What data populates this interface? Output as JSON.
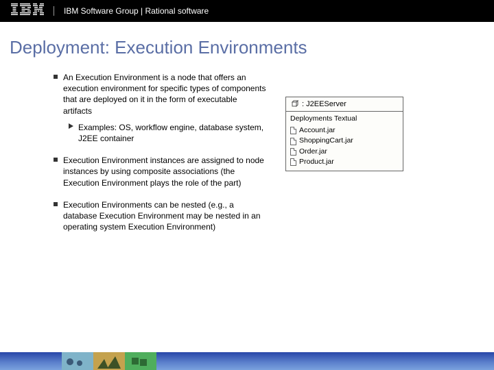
{
  "header": {
    "breadcrumb": "IBM Software Group | Rational software"
  },
  "title": "Deployment: Execution Environments",
  "bullets": [
    {
      "text": "An Execution Environment is a node that offers an execution environment for specific types of components that are deployed on it in the form of executable artifacts",
      "sub": [
        "Examples: OS, workflow engine, database system, J2EE container"
      ]
    },
    {
      "text": "Execution Environment instances are assigned to node instances by using composite associations (the Execution Environment plays the role of the part)"
    },
    {
      "text": "Execution Environments can be nested (e.g., a database Execution Environment may be nested in an operating system Execution Environment)"
    }
  ],
  "diagram": {
    "node_title": ": J2EEServer",
    "section_label": "Deployments Textual",
    "artifacts": [
      "Account.jar",
      "ShoppingCart.jar",
      "Order.jar",
      "Product.jar"
    ]
  }
}
